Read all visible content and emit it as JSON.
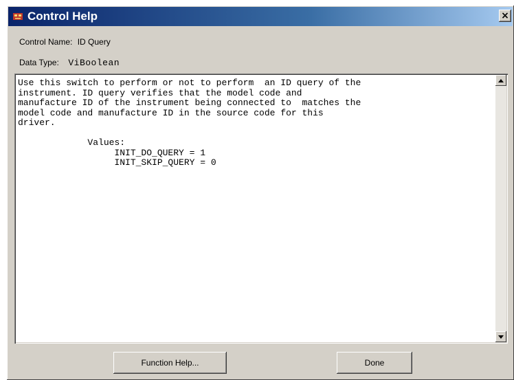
{
  "window": {
    "title": "Control Help",
    "close_label": "×"
  },
  "info": {
    "control_name_label": "Control Name:",
    "control_name_value": "ID Query",
    "data_type_label": "Data Type:",
    "data_type_value": "ViBoolean"
  },
  "help_text": "Use this switch to perform or not to perform  an ID query of the\ninstrument. ID query verifies that the model code and\nmanufacture ID of the instrument being connected to  matches the\nmodel code and manufacture ID in the source code for this\ndriver.\n\n             Values:\n                  INIT_DO_QUERY = 1\n                  INIT_SKIP_QUERY = 0",
  "buttons": {
    "function_help": "Function Help...",
    "done": "Done"
  }
}
